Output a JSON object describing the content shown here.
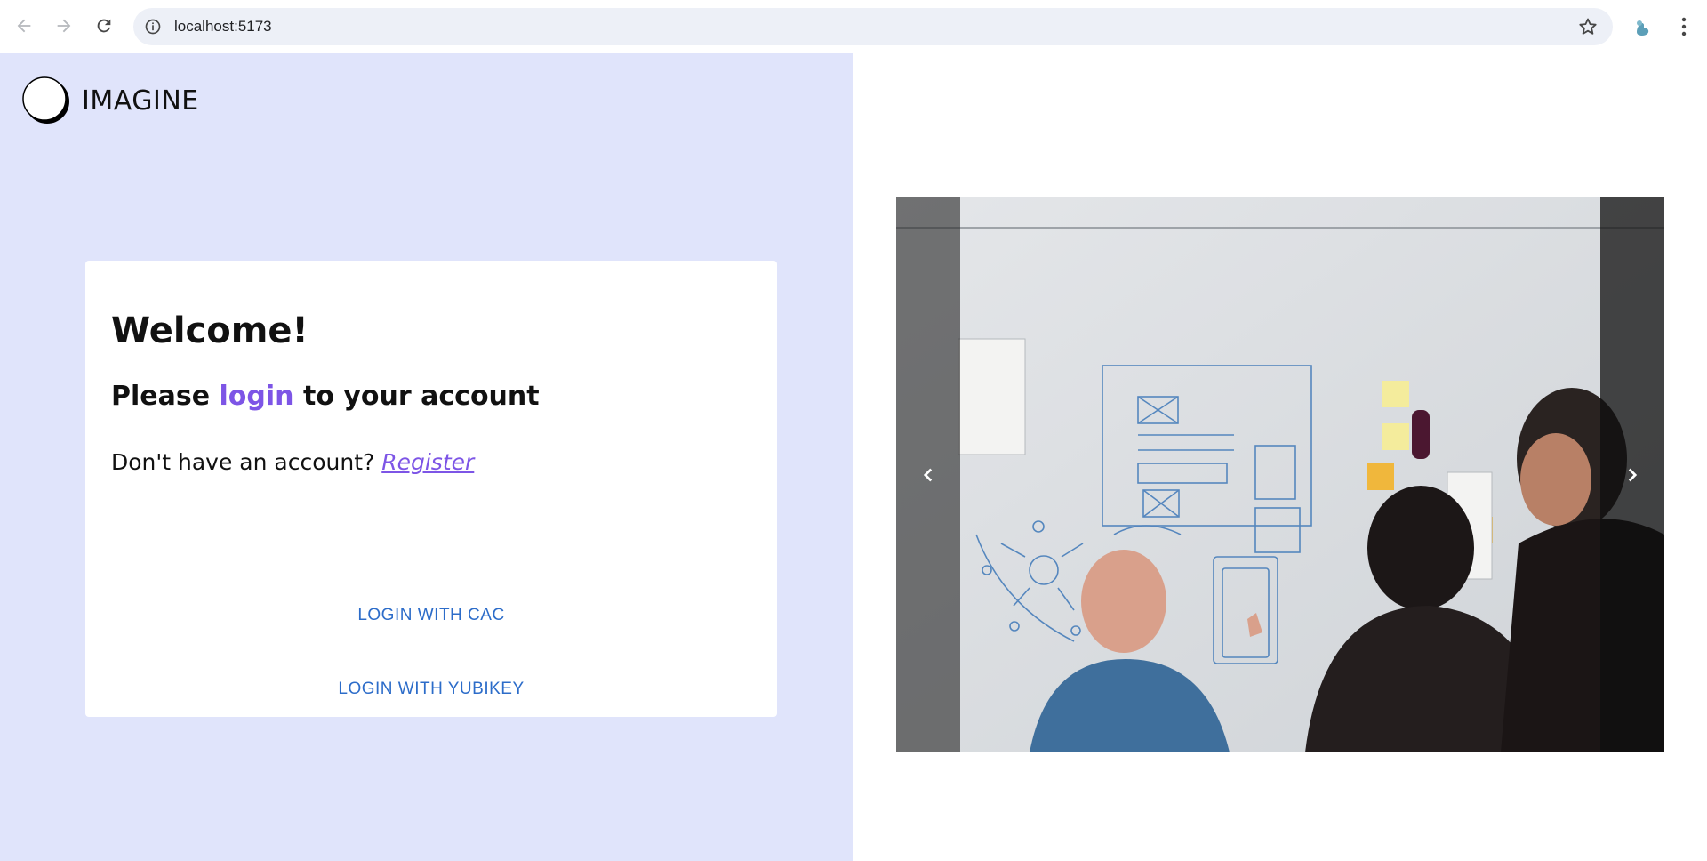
{
  "browser": {
    "url": "localhost:5173",
    "icons": [
      "back-icon",
      "forward-icon",
      "reload-icon",
      "site-info-icon",
      "bookmark-star-icon",
      "profile-avatar-icon",
      "more-menu-icon"
    ]
  },
  "brand": {
    "name": "IMAGINE"
  },
  "login": {
    "title": "Welcome!",
    "subtitle_prefix": "Please ",
    "subtitle_accent": "login",
    "subtitle_suffix": " to your account",
    "register_prompt": "Don't have an account? ",
    "register_link": "Register",
    "cac_button": "LOGIN WITH CAC",
    "yubikey_button": "LOGIN WITH YUBIKEY"
  },
  "carousel": {
    "prev_icon": "chevron-left-icon",
    "next_icon": "chevron-right-icon"
  },
  "colors": {
    "left_panel_bg": "#e0e4fb",
    "accent_purple": "#7d55e6",
    "button_blue": "#2c6cc9"
  }
}
